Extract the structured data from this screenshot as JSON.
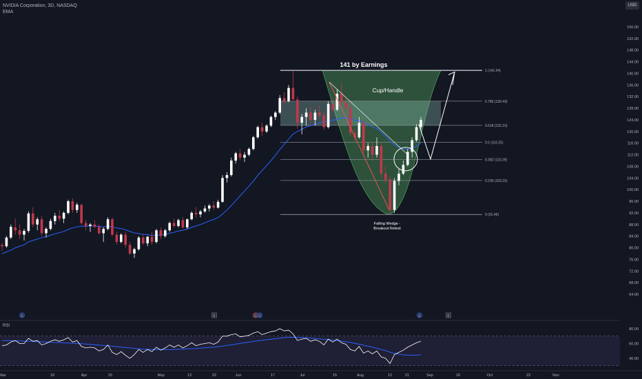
{
  "header": {
    "symbol_line": "NVIDIA Corporation, 3D, NASDAQ",
    "indicator": "EMA",
    "currency": "USD"
  },
  "rsi_label": "RSI",
  "colors": {
    "background": "#131722",
    "up_candle": "#ffffff",
    "down_candle": "#c0394b",
    "ema_line": "#2962ff",
    "cup_fill": "#4e9a5b",
    "fib_zone_fill": "#9ccfc4",
    "rsi_line": "#ffffff",
    "rsi_ma": "#2962ff"
  },
  "chart_data": {
    "type": "candlestick",
    "title": "141 by Earnings",
    "annotations": {
      "pattern": "Cup/Handle",
      "wedge_line1": "Falling Wedge -",
      "wedge_line2": "Breakout Retest"
    },
    "x_axis_labels": [
      "Mar",
      "18",
      "Apr",
      "15",
      "May",
      "13",
      "22",
      "Jun",
      "17",
      "Jul",
      "15",
      "Aug",
      "12",
      "21",
      "Sep",
      "16",
      "Oct",
      "23",
      "Nov"
    ],
    "y_ticks": [
      "156.00",
      "152.00",
      "148.00",
      "144.00",
      "140.00",
      "136.00",
      "132.00",
      "128.00",
      "124.00",
      "120.00",
      "116.00",
      "112.00",
      "108.00",
      "104.00",
      "100.00",
      "96.00",
      "92.00",
      "88.00",
      "84.00",
      "80.00",
      "76.00",
      "72.00",
      "68.00",
      "64.00"
    ],
    "ylim": [
      62,
      160
    ],
    "fib_levels": [
      {
        "ratio": "1",
        "label": "1 (141.04)",
        "price": 141.04
      },
      {
        "ratio": "0.786",
        "label": "0.786 (130.43)",
        "price": 130.43
      },
      {
        "ratio": "0.618",
        "label": "0.618 (122.10)",
        "price": 122.1
      },
      {
        "ratio": "0.5",
        "label": "0.5 (116.25)",
        "price": 116.25
      },
      {
        "ratio": "0.382",
        "label": "0.382 (110.39)",
        "price": 110.39
      },
      {
        "ratio": "0.236",
        "label": "0.236 (103.15)",
        "price": 103.15
      },
      {
        "ratio": "0",
        "label": "0 (91.45)",
        "price": 91.45
      }
    ],
    "rsi_ticks": [
      "80.00",
      "60.00",
      "40.00"
    ],
    "rsi_levels": [
      70,
      30
    ],
    "event_markers": [
      "D",
      "E",
      "D",
      "D",
      "D",
      "E"
    ],
    "candles": [
      [
        81,
        81.6,
        79,
        80.5
      ],
      [
        80.5,
        84,
        80,
        83.5
      ],
      [
        83.5,
        88,
        83,
        87.2
      ],
      [
        87,
        90,
        84.5,
        86
      ],
      [
        86,
        88,
        83,
        84.5
      ],
      [
        84.5,
        86.5,
        82.5,
        85.8
      ],
      [
        85.8,
        92.5,
        85.2,
        91.8
      ],
      [
        91.8,
        94,
        87,
        88
      ],
      [
        88,
        90.5,
        86,
        89.8
      ],
      [
        89.8,
        91,
        84,
        85
      ],
      [
        85,
        87,
        83.5,
        86.5
      ],
      [
        86.5,
        90,
        86,
        89.2
      ],
      [
        89.2,
        92,
        88,
        91
      ],
      [
        91,
        93,
        89,
        90
      ],
      [
        90,
        92.5,
        88.5,
        92
      ],
      [
        92,
        96.5,
        91.5,
        96
      ],
      [
        96,
        97,
        92,
        93
      ],
      [
        93,
        95.5,
        92,
        94.8
      ],
      [
        94.8,
        95,
        88,
        88.5
      ],
      [
        88.5,
        89.5,
        86,
        87.5
      ],
      [
        87.5,
        88.5,
        85.5,
        88
      ],
      [
        88,
        89.5,
        86.8,
        87.2
      ],
      [
        87.2,
        88,
        84.5,
        85
      ],
      [
        85,
        87,
        82,
        86.5
      ],
      [
        86.5,
        90.5,
        86,
        89.8
      ],
      [
        89.8,
        90.5,
        84,
        84.5
      ],
      [
        84.5,
        85.5,
        81,
        82
      ],
      [
        82,
        85,
        81.5,
        84.5
      ],
      [
        84.5,
        85.5,
        80,
        81
      ],
      [
        81,
        82,
        77.5,
        78
      ],
      [
        78,
        80,
        76.5,
        79.5
      ],
      [
        79.5,
        84,
        79,
        83.5
      ],
      [
        83.5,
        84.5,
        81,
        81.5
      ],
      [
        81.5,
        84,
        80.5,
        83.8
      ],
      [
        83.8,
        85.5,
        81,
        82
      ],
      [
        82,
        86.5,
        81.5,
        86
      ],
      [
        86,
        87,
        83,
        84
      ],
      [
        84,
        86.5,
        83.5,
        86
      ],
      [
        86,
        89,
        85.5,
        88.5
      ],
      [
        88.5,
        90,
        87,
        87.5
      ],
      [
        87.5,
        90,
        87,
        89.5
      ],
      [
        89.5,
        90.5,
        86.5,
        87
      ],
      [
        87,
        90,
        86.5,
        89.8
      ],
      [
        89.8,
        92.5,
        89.5,
        92
      ],
      [
        92,
        94,
        90.5,
        91.5
      ],
      [
        91.5,
        93,
        90.5,
        92.5
      ],
      [
        92.5,
        94.5,
        92,
        93.5
      ],
      [
        93.5,
        95,
        92.5,
        94.5
      ],
      [
        94.5,
        96,
        93,
        93.8
      ],
      [
        93.8,
        96.5,
        93.5,
        95.8
      ],
      [
        95.8,
        105,
        95.5,
        104
      ],
      [
        104,
        106,
        102.5,
        105
      ],
      [
        105,
        111,
        104.5,
        110
      ],
      [
        110,
        113,
        109,
        112.5
      ],
      [
        112.5,
        114,
        110,
        111
      ],
      [
        111,
        113,
        109.5,
        112
      ],
      [
        112,
        114.5,
        111.5,
        114
      ],
      [
        114,
        118.5,
        113.5,
        118
      ],
      [
        118,
        122,
        117.5,
        121.5
      ],
      [
        121.5,
        123,
        118.5,
        120
      ],
      [
        120,
        122.5,
        119.5,
        122
      ],
      [
        122,
        125.5,
        121.5,
        125
      ],
      [
        125,
        127,
        124,
        126.5
      ],
      [
        126.5,
        132.5,
        126,
        131.5
      ],
      [
        131.5,
        133.5,
        129.5,
        130.5
      ],
      [
        130.5,
        136,
        130,
        135
      ],
      [
        135,
        141,
        134,
        131
      ],
      [
        131,
        132,
        121,
        123
      ],
      [
        123,
        126,
        119,
        125
      ],
      [
        125,
        128,
        122,
        126.5
      ],
      [
        126.5,
        128.5,
        123,
        124
      ],
      [
        124,
        127.5,
        122,
        126.5
      ],
      [
        126.5,
        129,
        124.5,
        125.5
      ],
      [
        125.5,
        127,
        120.5,
        121.5
      ],
      [
        121.5,
        130.5,
        121,
        129.5
      ],
      [
        129.5,
        131.5,
        126.5,
        127.5
      ],
      [
        127.5,
        134.5,
        127,
        133
      ],
      [
        133,
        136.5,
        129,
        130
      ],
      [
        130,
        132,
        127.5,
        128
      ],
      [
        128,
        130,
        118.5,
        119.5
      ],
      [
        119.5,
        121,
        116.5,
        118
      ],
      [
        118,
        125,
        117.5,
        123
      ],
      [
        123,
        124,
        112.5,
        113.5
      ],
      [
        113.5,
        116,
        111,
        115
      ],
      [
        115,
        116.5,
        110,
        112
      ],
      [
        112,
        118,
        111,
        115
      ],
      [
        115,
        116,
        104,
        105.5
      ],
      [
        105.5,
        108,
        102,
        103.5
      ],
      [
        103.5,
        104.5,
        92,
        93
      ],
      [
        93,
        104,
        92,
        103
      ],
      [
        103,
        107,
        101.5,
        105.5
      ],
      [
        105.5,
        110,
        105,
        108.5
      ],
      [
        108.5,
        114,
        108,
        113
      ],
      [
        113,
        118,
        111,
        117
      ],
      [
        117,
        122.5,
        116.5,
        121.5
      ],
      [
        121.5,
        125,
        120,
        124
      ]
    ],
    "ema": [
      78,
      78.5,
      79.2,
      80,
      80.5,
      81,
      82,
      82.5,
      83,
      83.5,
      83.8,
      84.3,
      84.8,
      85.2,
      85.6,
      86.3,
      86.8,
      87.2,
      87.4,
      87.4,
      87.5,
      87.5,
      87.3,
      87.2,
      87.4,
      87.2,
      86.8,
      86.6,
      86.2,
      85.6,
      85.1,
      84.9,
      84.6,
      84.5,
      84.2,
      84.4,
      84.4,
      84.6,
      85,
      85.3,
      85.8,
      86,
      86.4,
      87,
      87.5,
      88,
      88.6,
      89.2,
      89.7,
      90.4,
      91.6,
      93,
      94.5,
      96.2,
      97.9,
      99.5,
      101.2,
      102.9,
      104.9,
      106.6,
      108.2,
      110,
      111.8,
      113.8,
      115.6,
      117.4,
      119.1,
      120,
      120.8,
      121.6,
      122,
      122.5,
      123,
      123.2,
      123.5,
      123.9,
      124.2,
      124.5,
      124.8,
      124.3,
      123.9,
      123.8,
      123,
      122.4,
      121.6,
      121,
      119.7,
      118.4,
      116.6,
      115.4,
      114.6,
      114,
      113.9,
      114.2,
      115,
      116
    ],
    "rsi": [
      57,
      58,
      62,
      64,
      60,
      60,
      67,
      63,
      64,
      58,
      60,
      63,
      65,
      63,
      65,
      68,
      62,
      64,
      56,
      54,
      55,
      54,
      50,
      52,
      58,
      48,
      45,
      49,
      44,
      40,
      45,
      52,
      48,
      52,
      49,
      55,
      51,
      54,
      58,
      55,
      58,
      54,
      57,
      61,
      57,
      59,
      60,
      61,
      59,
      62,
      70,
      70,
      72,
      73,
      69,
      70,
      71,
      74,
      76,
      72,
      74,
      76,
      77,
      80,
      77,
      78,
      73,
      64,
      66,
      67,
      63,
      65,
      63,
      58,
      66,
      62,
      66,
      61,
      59,
      52,
      50,
      56,
      47,
      50,
      46,
      50,
      42,
      40,
      33,
      45,
      48,
      51,
      55,
      58,
      61,
      63
    ],
    "rsi_ma": [
      64,
      63.8,
      63.7,
      63.6,
      63.4,
      63.2,
      63,
      62.8,
      62.6,
      62.3,
      62,
      61.7,
      61.4,
      61.1,
      60.9,
      60.7,
      60.4,
      60.1,
      59.7,
      59.3,
      58.8,
      58.3,
      57.8,
      57.3,
      56.9,
      56.4,
      55.8,
      55.2,
      54.6,
      54,
      53.4,
      52.9,
      52.5,
      52.2,
      52,
      51.9,
      51.8,
      51.8,
      51.9,
      52,
      52.2,
      52.4,
      52.7,
      53,
      53.3,
      53.7,
      54.1,
      54.6,
      55.1,
      55.7,
      56.5,
      57.3,
      58.2,
      59.2,
      60.1,
      61,
      61.9,
      62.8,
      63.7,
      64.4,
      65.1,
      65.8,
      66.5,
      67.3,
      67.9,
      68.4,
      68.5,
      68.2,
      67.9,
      67.6,
      67.2,
      66.8,
      66.3,
      65.6,
      65.2,
      64.6,
      64,
      63.3,
      62.4,
      61.4,
      60.2,
      59.1,
      57.7,
      56.4,
      55,
      53.6,
      52,
      50.3,
      48.3,
      46.7,
      45.6,
      44.7,
      44.3,
      44.2,
      44.5,
      44.9
    ]
  }
}
